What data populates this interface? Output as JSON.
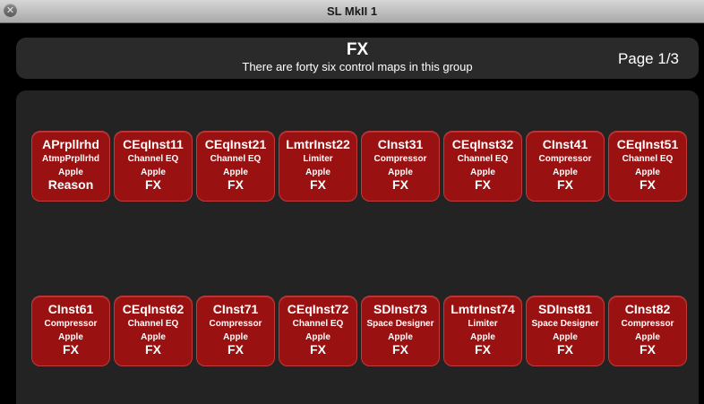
{
  "window": {
    "title": "SL MkII 1",
    "close_icon": "close-icon"
  },
  "header": {
    "title": "FX",
    "subtitle": "There are forty six control maps in this group",
    "page": "Page 1/3"
  },
  "colors": {
    "button_bg": "#9a1111",
    "panel_bg": "#232323",
    "window_bg": "#000000"
  },
  "maps": [
    {
      "name": "APrpllrhd",
      "plugin": "AtmpPrpllrhd",
      "maker": "Apple",
      "group": "Reason"
    },
    {
      "name": "CEqInst11",
      "plugin": "Channel EQ",
      "maker": "Apple",
      "group": "FX"
    },
    {
      "name": "CEqInst21",
      "plugin": "Channel EQ",
      "maker": "Apple",
      "group": "FX"
    },
    {
      "name": "LmtrInst22",
      "plugin": "Limiter",
      "maker": "Apple",
      "group": "FX"
    },
    {
      "name": "CInst31",
      "plugin": "Compressor",
      "maker": "Apple",
      "group": "FX"
    },
    {
      "name": "CEqInst32",
      "plugin": "Channel EQ",
      "maker": "Apple",
      "group": "FX"
    },
    {
      "name": "CInst41",
      "plugin": "Compressor",
      "maker": "Apple",
      "group": "FX"
    },
    {
      "name": "CEqInst51",
      "plugin": "Channel EQ",
      "maker": "Apple",
      "group": "FX"
    },
    {
      "name": "CInst61",
      "plugin": "Compressor",
      "maker": "Apple",
      "group": "FX"
    },
    {
      "name": "CEqInst62",
      "plugin": "Channel EQ",
      "maker": "Apple",
      "group": "FX"
    },
    {
      "name": "CInst71",
      "plugin": "Compressor",
      "maker": "Apple",
      "group": "FX"
    },
    {
      "name": "CEqInst72",
      "plugin": "Channel EQ",
      "maker": "Apple",
      "group": "FX"
    },
    {
      "name": "SDInst73",
      "plugin": "Space Designer",
      "maker": "Apple",
      "group": "FX"
    },
    {
      "name": "LmtrInst74",
      "plugin": "Limiter",
      "maker": "Apple",
      "group": "FX"
    },
    {
      "name": "SDInst81",
      "plugin": "Space Designer",
      "maker": "Apple",
      "group": "FX"
    },
    {
      "name": "CInst82",
      "plugin": "Compressor",
      "maker": "Apple",
      "group": "FX"
    }
  ]
}
